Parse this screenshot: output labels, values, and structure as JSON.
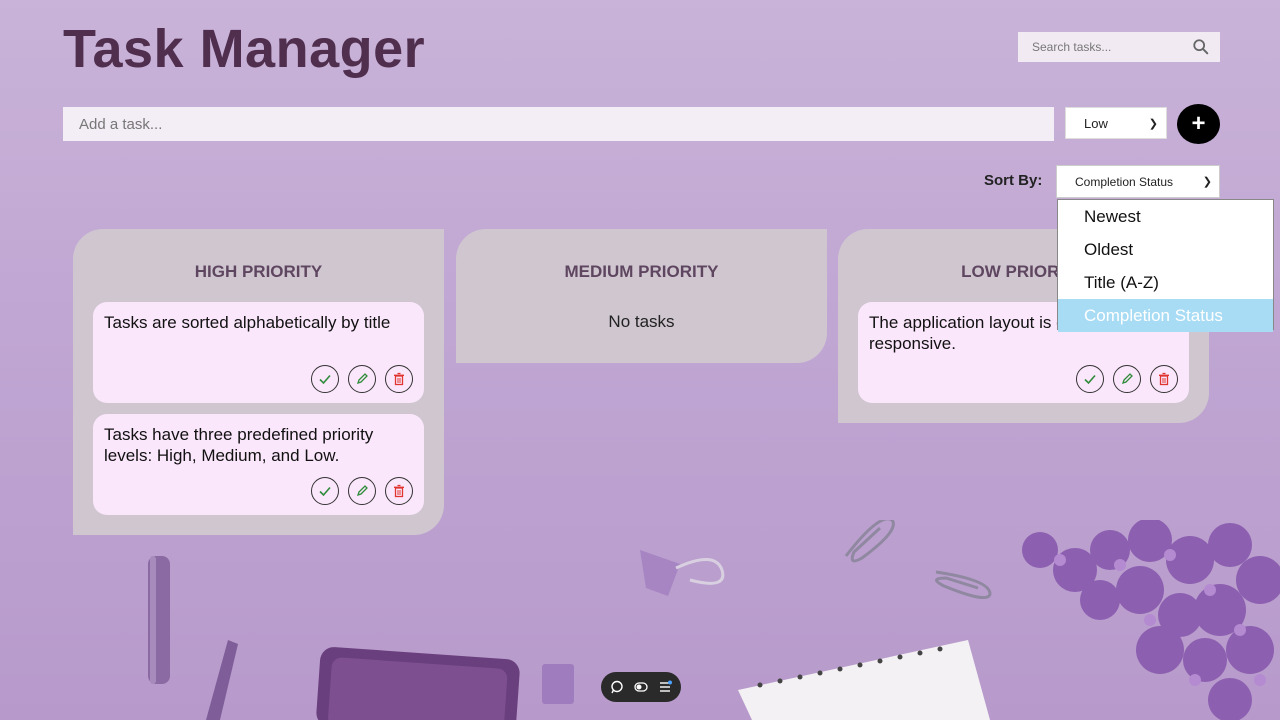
{
  "app": {
    "title": "Task Manager"
  },
  "search": {
    "placeholder": "Search tasks...",
    "icon": "search-icon"
  },
  "add_task": {
    "placeholder": "Add a task...",
    "priority_value": "Low",
    "add_label": "+"
  },
  "sort": {
    "label": "Sort By:",
    "selected": "Completion Status",
    "options": [
      "Newest",
      "Oldest",
      "Title (A-Z)",
      "Completion Status"
    ]
  },
  "columns": [
    {
      "title": "HIGH PRIORITY",
      "tasks": [
        {
          "text": "Tasks are sorted alphabetically by title"
        },
        {
          "text": "Tasks have three predefined priority levels: High, Medium, and Low."
        }
      ]
    },
    {
      "title": "MEDIUM PRIORITY",
      "empty_text": "No tasks",
      "tasks": []
    },
    {
      "title": "LOW PRIORITY",
      "tasks": [
        {
          "text": "The application layout is designed to be responsive."
        }
      ]
    }
  ],
  "colors": {
    "title": "#4f2e4e",
    "card": "#fbe7fb",
    "column": "#cfc6d0",
    "check": "#2e8b3a",
    "edit": "#2e8b3a",
    "delete": "#e0342f",
    "dropdown_selected": "#a8dcf4"
  }
}
